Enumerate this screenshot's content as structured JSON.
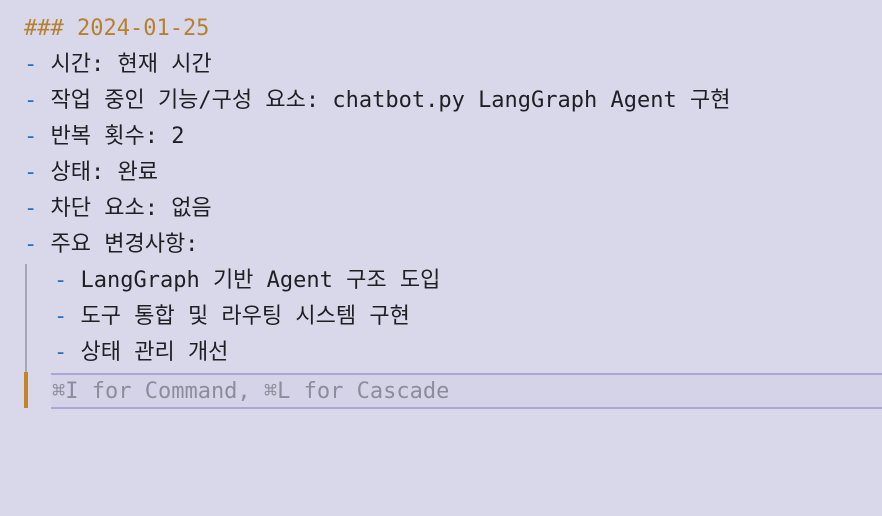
{
  "doc": {
    "heading": "### 2024-01-25",
    "bullet": "-",
    "items": [
      " 시간: 현재 시간",
      " 작업 중인 기능/구성 요소: chatbot.py LangGraph Agent 구현",
      " 반복 횟수: 2",
      " 상태: 완료",
      " 차단 요소: 없음",
      " 주요 변경사항:"
    ],
    "sub_items": [
      " LangGraph 기반 Agent 구조 도입",
      " 도구 통합 및 라우팅 시스템 구현",
      " 상태 관리 개선"
    ]
  },
  "inline_prompt": {
    "placeholder": "⌘I for Command, ⌘L for Cascade",
    "value": ""
  },
  "colors": {
    "background": "#d9d8ea",
    "heading": "#b5812f",
    "bullet": "#2f6fc2",
    "cursor_bar": "#c5832a",
    "input_border": "#a9a6d8"
  }
}
